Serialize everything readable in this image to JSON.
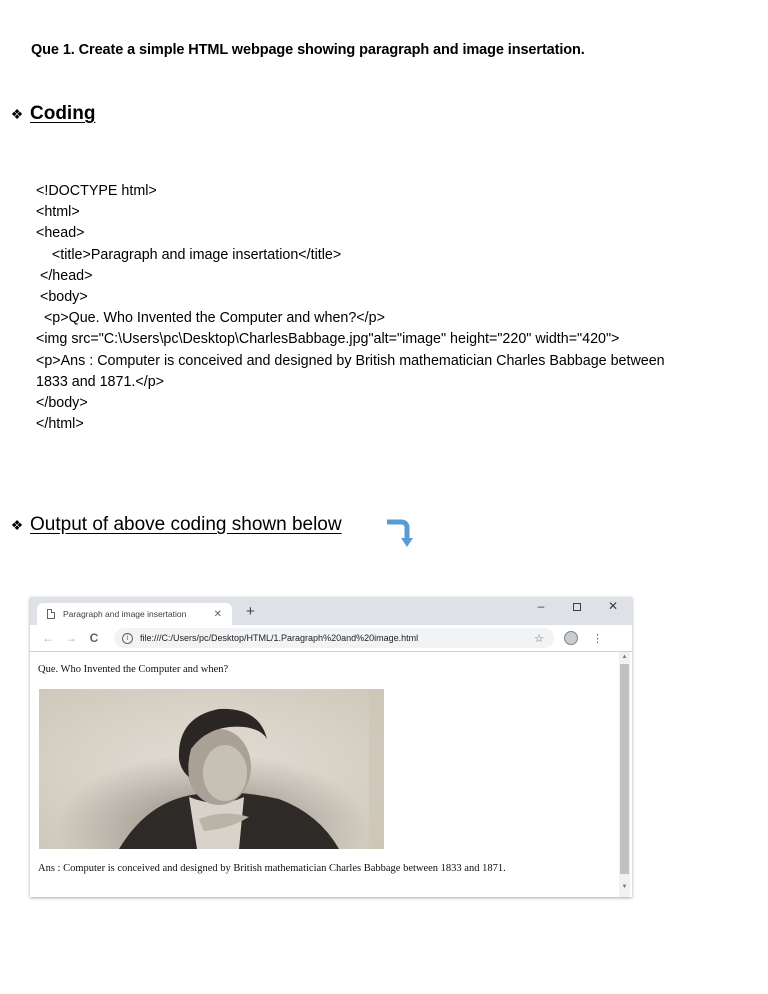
{
  "question": "Que 1. Create a simple HTML webpage showing paragraph and image insertation.",
  "sections": {
    "coding": {
      "bullet": "❖",
      "label": "Coding"
    },
    "output": {
      "bullet": "❖",
      "label": "Output of above coding shown below",
      "arrow_icon": "curved-arrow-down-icon",
      "arrow_color": "#5b9bd5"
    }
  },
  "code_lines": [
    "<!DOCTYPE html>",
    "<html>",
    "<head>",
    "    <title>Paragraph and image insertation</title>",
    " </head>",
    " <body>",
    "  <p>Que. Who Invented the Computer and when?</p>",
    "<img src=\"C:\\Users\\pc\\Desktop\\CharlesBabbage.jpg\"alt=\"image\" height=\"220\" width=\"420\">",
    "<p>Ans : Computer is conceived and designed by British mathematician Charles Babbage between",
    "1833 and 1871.</p>",
    "</body>",
    "</html>"
  ],
  "browser": {
    "tab_title": "Paragraph and image insertation",
    "tab_close": "✕",
    "new_tab": "+",
    "window_controls": {
      "minimize": "–",
      "close": "✕"
    },
    "nav": {
      "back": "←",
      "forward": "→",
      "reload": "C"
    },
    "info_icon": "i",
    "url": "file:///C:/Users/pc/Desktop/HTML/1.Paragraph%20and%20image.html",
    "star": "☆",
    "menu": "⋮",
    "page": {
      "question": "Que. Who Invented the Computer and when?",
      "image_alt": "Portrait engraving of Charles Babbage",
      "answer": "Ans : Computer is conceived and designed by British mathematician Charles Babbage between 1833 and 1871."
    },
    "scroll": {
      "up": "▲",
      "down": "▼"
    }
  }
}
